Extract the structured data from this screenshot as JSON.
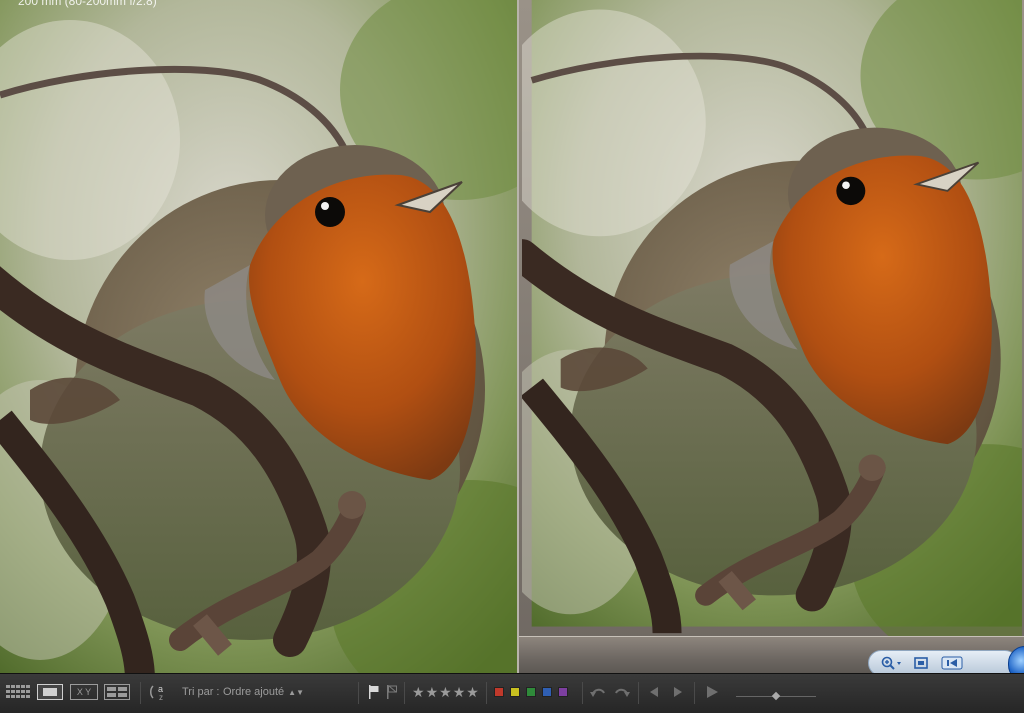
{
  "photo": {
    "exif_overlay": "200 mm (80-200mm f/2.8)"
  },
  "toolbar": {
    "sort_label": "Tri par :",
    "sort_value": "Ordre ajouté",
    "compare_label": "X Y",
    "stars": [
      "★",
      "★",
      "★",
      "★",
      "★"
    ],
    "color_labels": [
      "#c0392b",
      "#c8c020",
      "#2f8a3a",
      "#2f5fb3",
      "#7d3fa0"
    ]
  },
  "viewer": {
    "zoom_icon": "zoom-in-icon",
    "fit_icon": "fit-to-window-icon",
    "prev_icon": "previous-icon",
    "play_icon": "play-icon"
  }
}
